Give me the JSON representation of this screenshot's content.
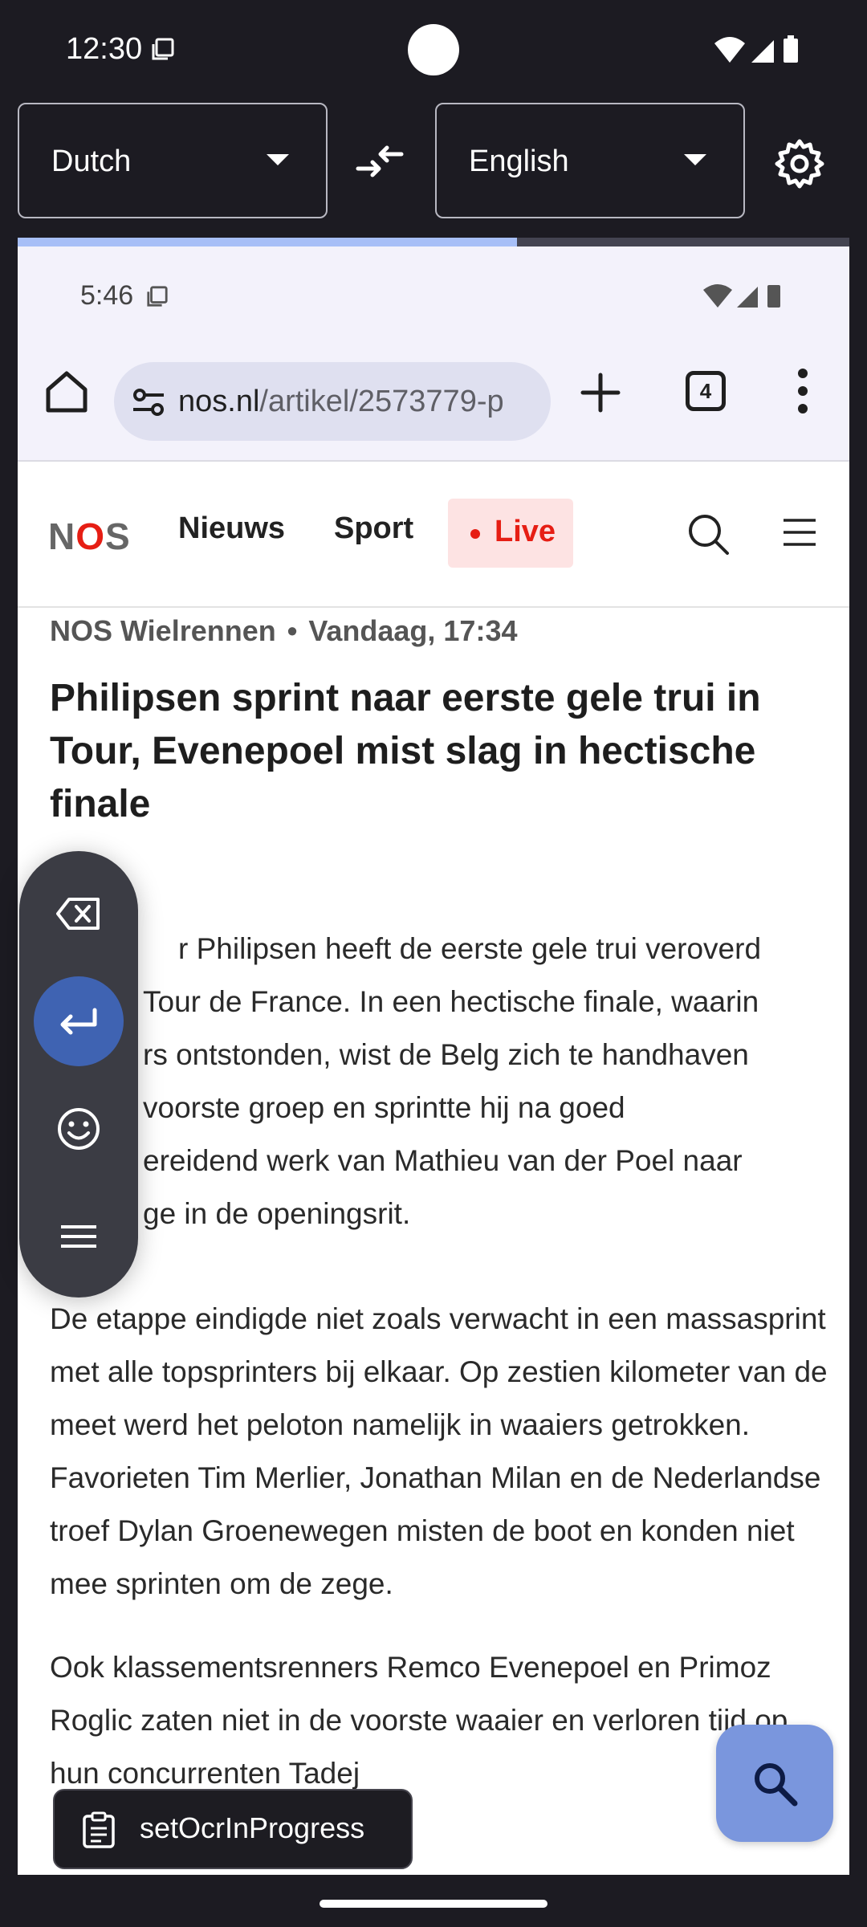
{
  "status_bar": {
    "time": "12:30"
  },
  "translator": {
    "source_language": "Dutch",
    "target_language": "English",
    "progress_fraction": 0.6
  },
  "inner_status_bar": {
    "time": "5:46"
  },
  "browser": {
    "url_host": "nos.nl",
    "url_path": "/artikel/2573779-p",
    "tab_count": "4"
  },
  "site": {
    "logo_n": "N",
    "logo_o": "O",
    "logo_s": "S",
    "nav": {
      "news": "Nieuws",
      "sport": "Sport",
      "live": "Live"
    }
  },
  "article": {
    "source": "NOS Wielrennen",
    "separator": "•",
    "date": "Vandaag, 17:34",
    "title": "Philipsen sprint naar eerste gele trui in Tour, Evenepoel mist slag in hectische finale",
    "para1": [
      "r Philipsen heeft de eerste gele trui veroverd",
      "Tour de France. In een hectische finale, waarin",
      "rs ontstonden, wist de Belg zich te handhaven",
      "voorste groep en sprintte hij na goed",
      "ereidend werk van Mathieu van der Poel naar",
      "ge in de openingsrit."
    ],
    "para2": "De etappe eindigde niet zoals verwacht in een massasprint met alle topsprinters bij elkaar. Op zestien kilometer van de meet werd het peloton namelijk in waaiers getrokken. Favorieten Tim Merlier, Jonathan Milan en de Nederlandse troef Dylan Groenewegen misten de boot en konden niet mee sprinten om de zege.",
    "para3": "Ook klassementsrenners Remco Evenepoel en Primoz Roglic zaten niet in de voorste waaier en verloren tijd op hun concurrenten Tadej"
  },
  "toast": {
    "label": "setOcrInProgress"
  },
  "colors": {
    "background": "#1c1b22",
    "progress": "#a7bff7",
    "nos_red": "#e61e14",
    "enter_button": "#3f63b2",
    "fab": "#7a96dd"
  }
}
